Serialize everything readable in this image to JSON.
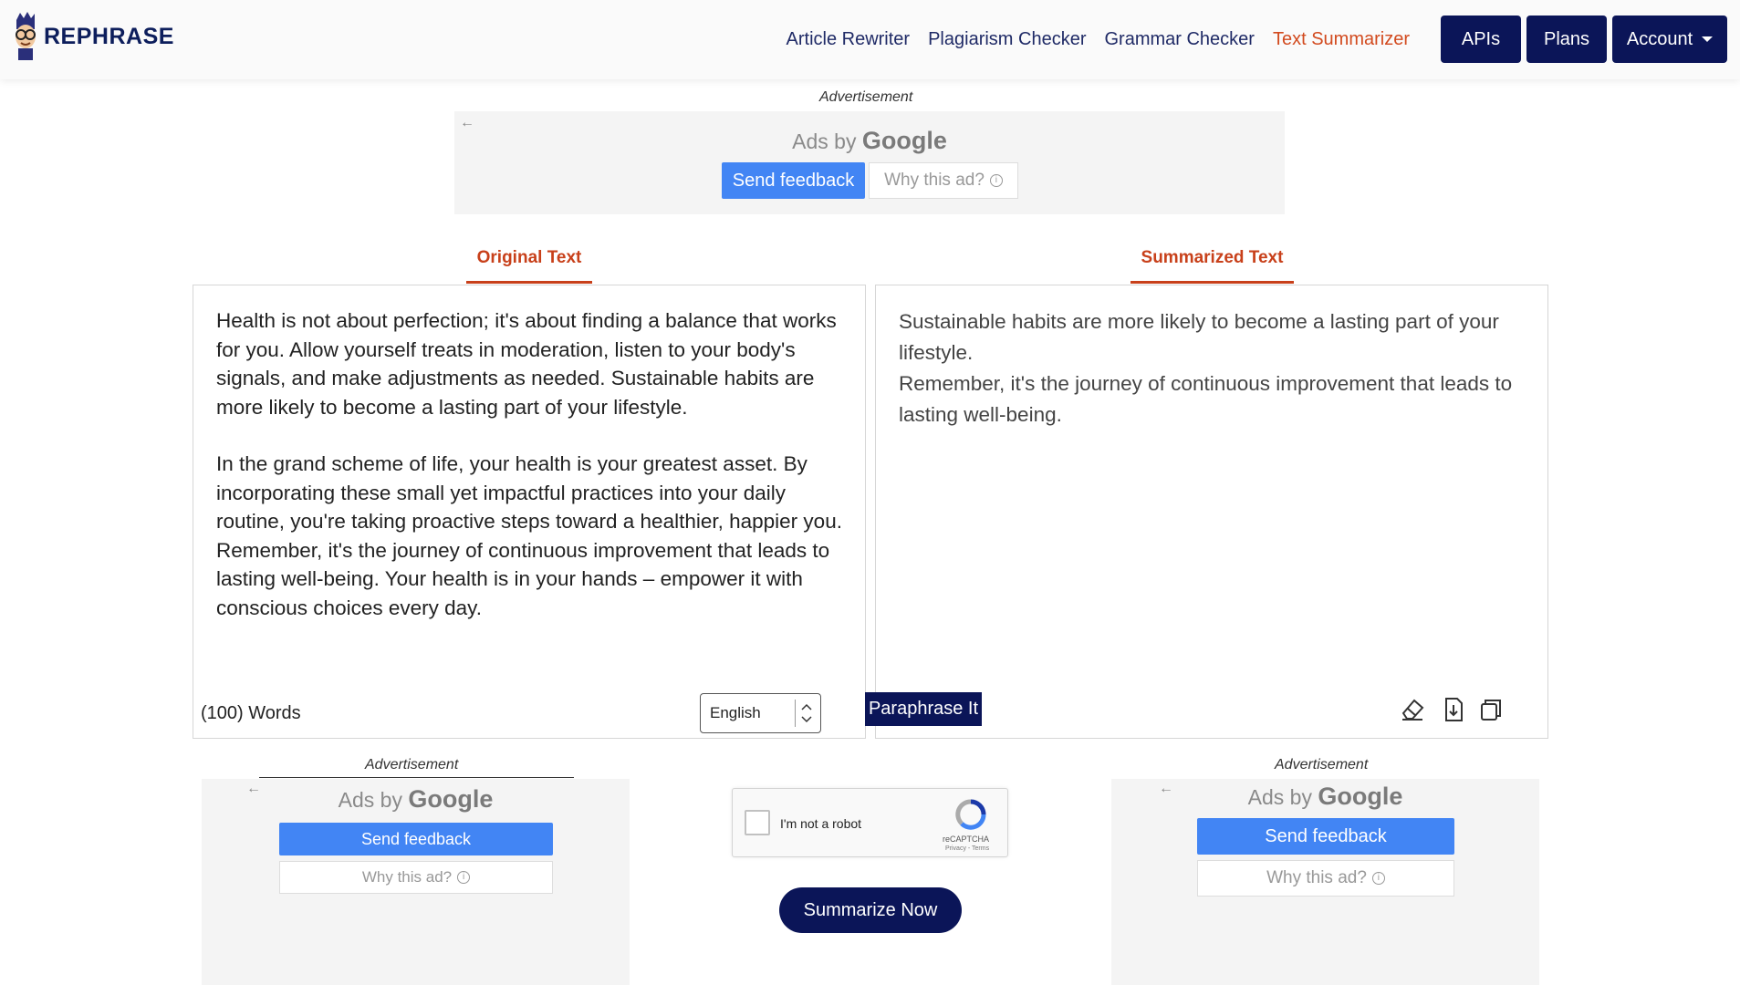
{
  "brand": {
    "name": "REPHRASE"
  },
  "nav": {
    "links": [
      "Article Rewriter",
      "Plagiarism Checker",
      "Grammar Checker",
      "Text Summarizer"
    ],
    "active": "Text Summarizer",
    "buttons": {
      "apis": "APIs",
      "plans": "Plans",
      "account": "Account"
    }
  },
  "ad_top": {
    "label": "Advertisement",
    "ads_by": "Ads by",
    "google": "Google",
    "send_feedback": "Send feedback",
    "why": "Why this ad?"
  },
  "tabs": {
    "original": "Original Text",
    "summarized": "Summarized Text"
  },
  "original": {
    "paragraphs": [
      "Health is not about perfection; it's about finding a balance that works for you. Allow yourself treats in moderation, listen to your body's signals, and make adjustments as needed. Sustainable habits are more likely to become a lasting part of your lifestyle.",
      "In the grand scheme of life, your health is your greatest asset. By incorporating these small yet impactful practices into your daily routine, you're taking proactive steps toward a healthier, happier you. Remember, it's the journey of continuous improvement that leads to lasting well-being. Your health is in your hands – empower it with conscious choices every day."
    ],
    "word_count": "(100) Words",
    "language": "English"
  },
  "summary": {
    "lines": [
      "Sustainable habits are more likely to become a lasting part of your lifestyle.",
      "Remember, it's the journey of continuous improvement that leads to lasting well-being."
    ],
    "paraphrase_button": "Paraphrase It",
    "icons": [
      "eraser-icon",
      "download-icon",
      "copy-icon"
    ]
  },
  "ad_left": {
    "label": "Advertisement",
    "ads_by": "Ads by",
    "google": "Google",
    "send_feedback": "Send feedback",
    "why": "Why this ad?"
  },
  "ad_right": {
    "label": "Advertisement",
    "ads_by": "Ads by",
    "google": "Google",
    "send_feedback": "Send feedback",
    "why": "Why this ad?"
  },
  "captcha": {
    "label": "I'm not a robot",
    "brand": "reCAPTCHA",
    "terms": "Privacy - Terms"
  },
  "summarize_button": "Summarize Now",
  "colors": {
    "navy": "#0b1558",
    "accent": "#c8401a",
    "google_blue": "#4285f4"
  }
}
